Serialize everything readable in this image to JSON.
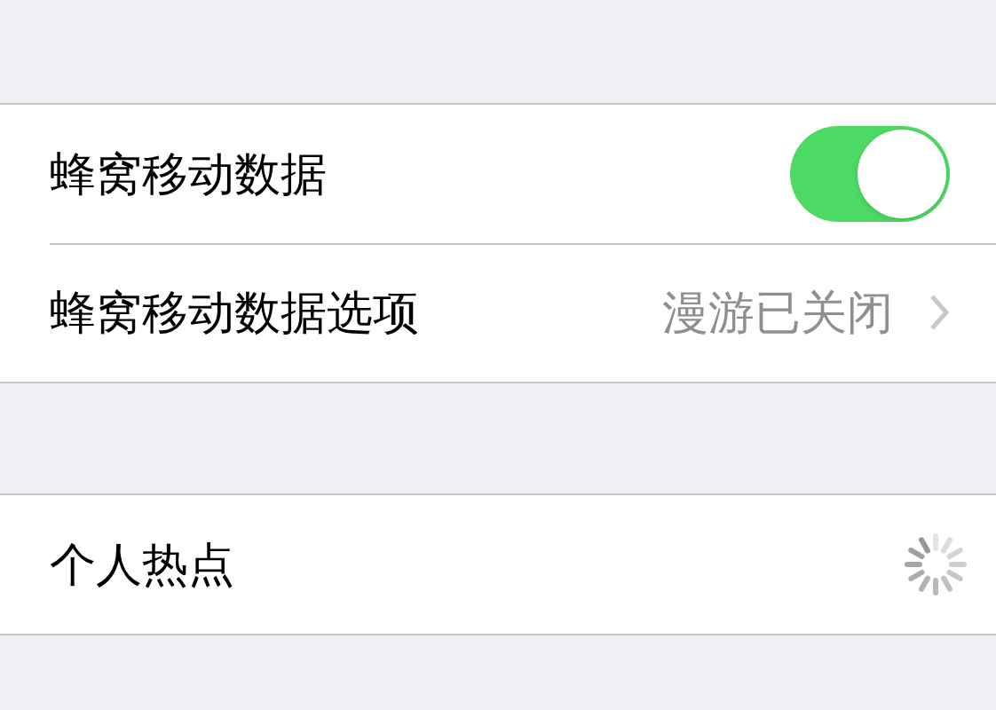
{
  "sections": [
    {
      "rows": [
        {
          "kind": "toggle",
          "label": "蜂窝移动数据",
          "on": true
        },
        {
          "kind": "detail",
          "label": "蜂窝移动数据选项",
          "value": "漫游已关闭"
        }
      ]
    },
    {
      "rows": [
        {
          "kind": "loading",
          "label": "个人热点"
        }
      ]
    }
  ]
}
